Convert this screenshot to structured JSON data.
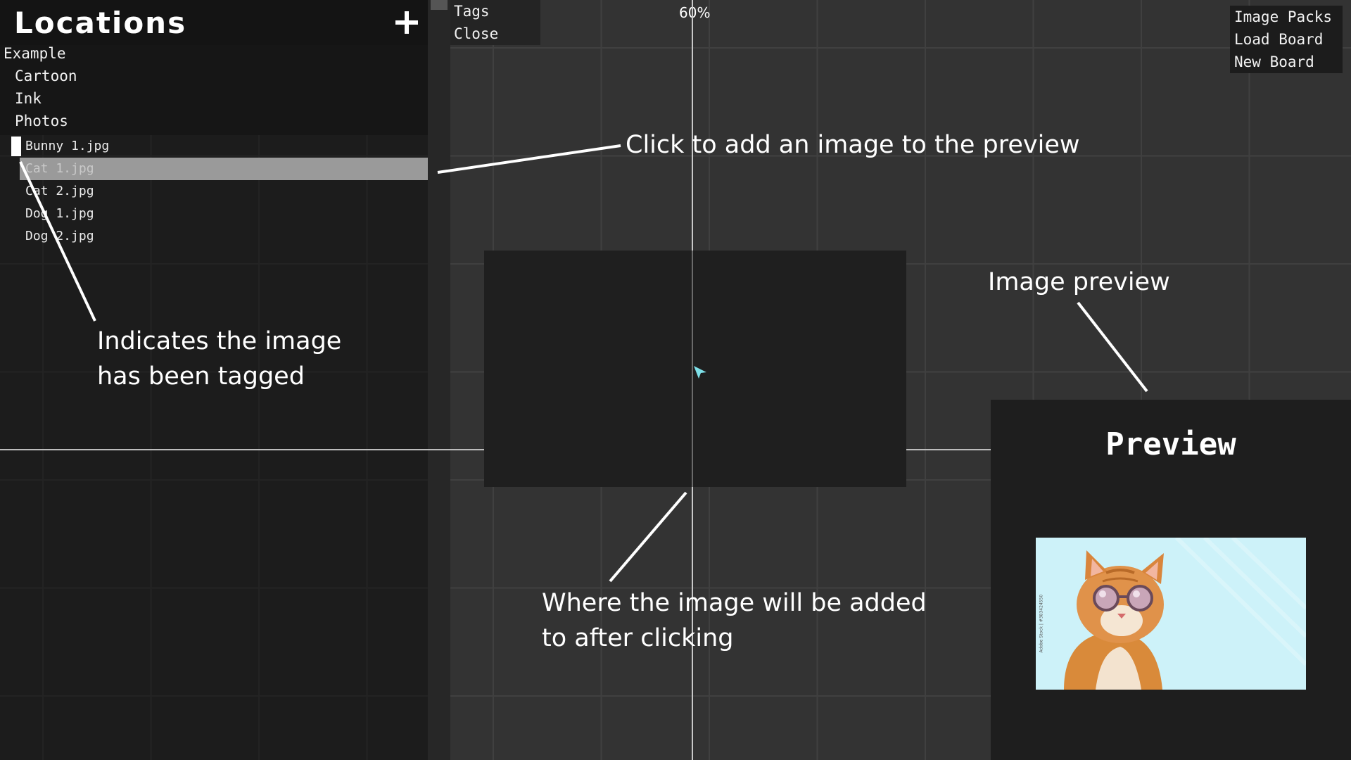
{
  "sidebar": {
    "title": "Locations",
    "add_label": "+",
    "tree": [
      {
        "label": "Example",
        "level": 0
      },
      {
        "label": "Cartoon",
        "level": 1
      },
      {
        "label": "Ink",
        "level": 1
      },
      {
        "label": "Photos",
        "level": 1
      }
    ],
    "files": [
      {
        "name": "Bunny 1.jpg",
        "tagged": true,
        "selected": false
      },
      {
        "name": "Cat 1.jpg",
        "tagged": false,
        "selected": true
      },
      {
        "name": "Cat 2.jpg",
        "tagged": false,
        "selected": false
      },
      {
        "name": "Dog 1.jpg",
        "tagged": false,
        "selected": false
      },
      {
        "name": "Dog 2.jpg",
        "tagged": false,
        "selected": false
      }
    ]
  },
  "toolbar": {
    "tags_label": "Tags",
    "close_label": "Close",
    "zoom": "60%"
  },
  "board_menu": {
    "image_packs": "Image Packs",
    "load_board": "Load Board",
    "new_board": "New Board"
  },
  "preview": {
    "title": "Preview",
    "image_watermark": "Adobe Stock | #383424550"
  },
  "annotations": {
    "click_to_add": "Click to add an image to the preview",
    "tag_indicator_line1": "Indicates the image",
    "tag_indicator_line2": "has been tagged",
    "image_preview": "Image preview",
    "drop_location_line1": "Where the image will be added",
    "drop_location_line2": "to after clicking"
  },
  "colors": {
    "canvas_bg": "#333333",
    "panel_bg": "#1c1c1c",
    "selection": "#9a9a9a",
    "cursor": "#7ee0e8"
  }
}
